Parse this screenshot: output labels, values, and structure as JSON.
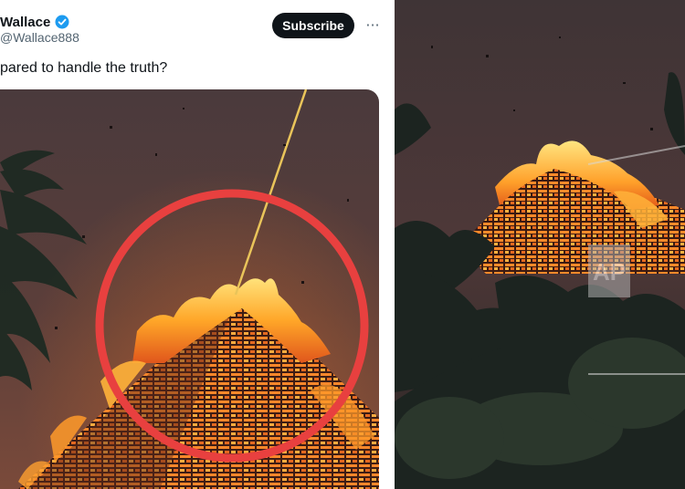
{
  "tweet": {
    "author_name": "Wallace",
    "handle": "Wallace888",
    "subscribe_label": "Subscribe",
    "more_label": "···",
    "text": "pared to handle the truth?",
    "verified_color": "#1d9bf0"
  },
  "images": {
    "left": {
      "subject": "burning-church-with-beam",
      "circle_color": "#e8403f",
      "beam_color": "#e9c45a"
    },
    "right": {
      "subject": "burning-church-wire-photo",
      "watermark": "AP"
    }
  }
}
